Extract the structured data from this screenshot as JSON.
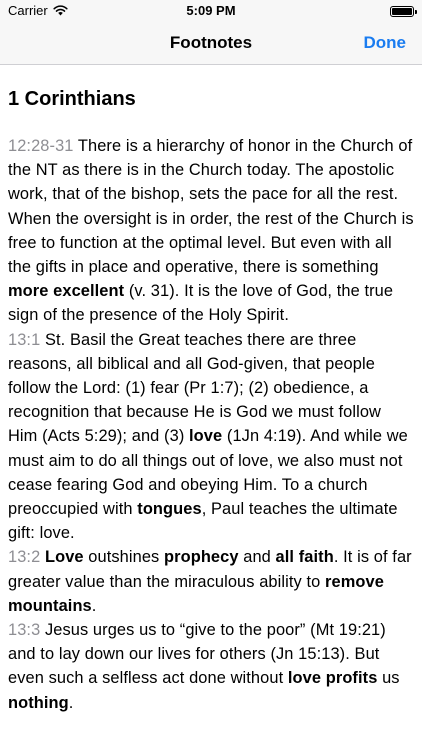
{
  "status_bar": {
    "carrier": "Carrier",
    "time": "5:09 PM"
  },
  "nav": {
    "title": "Footnotes",
    "done_label": "Done"
  },
  "book_title": "1 Corinthians",
  "footnotes": [
    {
      "ref": "12:28-31",
      "segments": [
        {
          "text": " There is a hierarchy of honor in the Church of the NT as there is in the Church today. The apostolic work, that of the bishop, sets the pace for all the rest. When the oversight is in order, the rest of the Church is free to function at the optimal level. But even with all the gifts in place and operative, there is something ",
          "bold": false
        },
        {
          "text": "more excellent",
          "bold": true
        },
        {
          "text": " (v. 31). It is the love of God, the true sign of the presence of the Holy Spirit.",
          "bold": false
        }
      ]
    },
    {
      "ref": "13:1",
      "segments": [
        {
          "text": " St. Basil the Great teaches there are three reasons, all biblical and all God-given, that people follow the Lord: (1) fear (Pr 1:7); (2) obedience, a recognition that because He is God we must follow Him (Acts 5:29); and (3) ",
          "bold": false
        },
        {
          "text": "love",
          "bold": true
        },
        {
          "text": " (1Jn 4:19). And while we must aim to do all things out of love, we also must not cease fearing God and obeying Him. To a church preoccupied with ",
          "bold": false
        },
        {
          "text": "tongues",
          "bold": true
        },
        {
          "text": ", Paul teaches the ultimate gift: love.",
          "bold": false
        }
      ]
    },
    {
      "ref": "13:2",
      "segments": [
        {
          "text": " ",
          "bold": false
        },
        {
          "text": "Love",
          "bold": true
        },
        {
          "text": " outshines ",
          "bold": false
        },
        {
          "text": "prophecy",
          "bold": true
        },
        {
          "text": " and ",
          "bold": false
        },
        {
          "text": "all faith",
          "bold": true
        },
        {
          "text": ". It is of far greater value than the miraculous ability to ",
          "bold": false
        },
        {
          "text": "remove mountains",
          "bold": true
        },
        {
          "text": ".",
          "bold": false
        }
      ]
    },
    {
      "ref": "13:3",
      "segments": [
        {
          "text": " Jesus urges us to “give to the poor” (Mt 19:21) and to lay down our lives for others (Jn 15:13). But even such a selfless act done without ",
          "bold": false
        },
        {
          "text": "love profits",
          "bold": true
        },
        {
          "text": " us ",
          "bold": false
        },
        {
          "text": "nothing",
          "bold": true
        },
        {
          "text": ".",
          "bold": false
        }
      ]
    }
  ]
}
